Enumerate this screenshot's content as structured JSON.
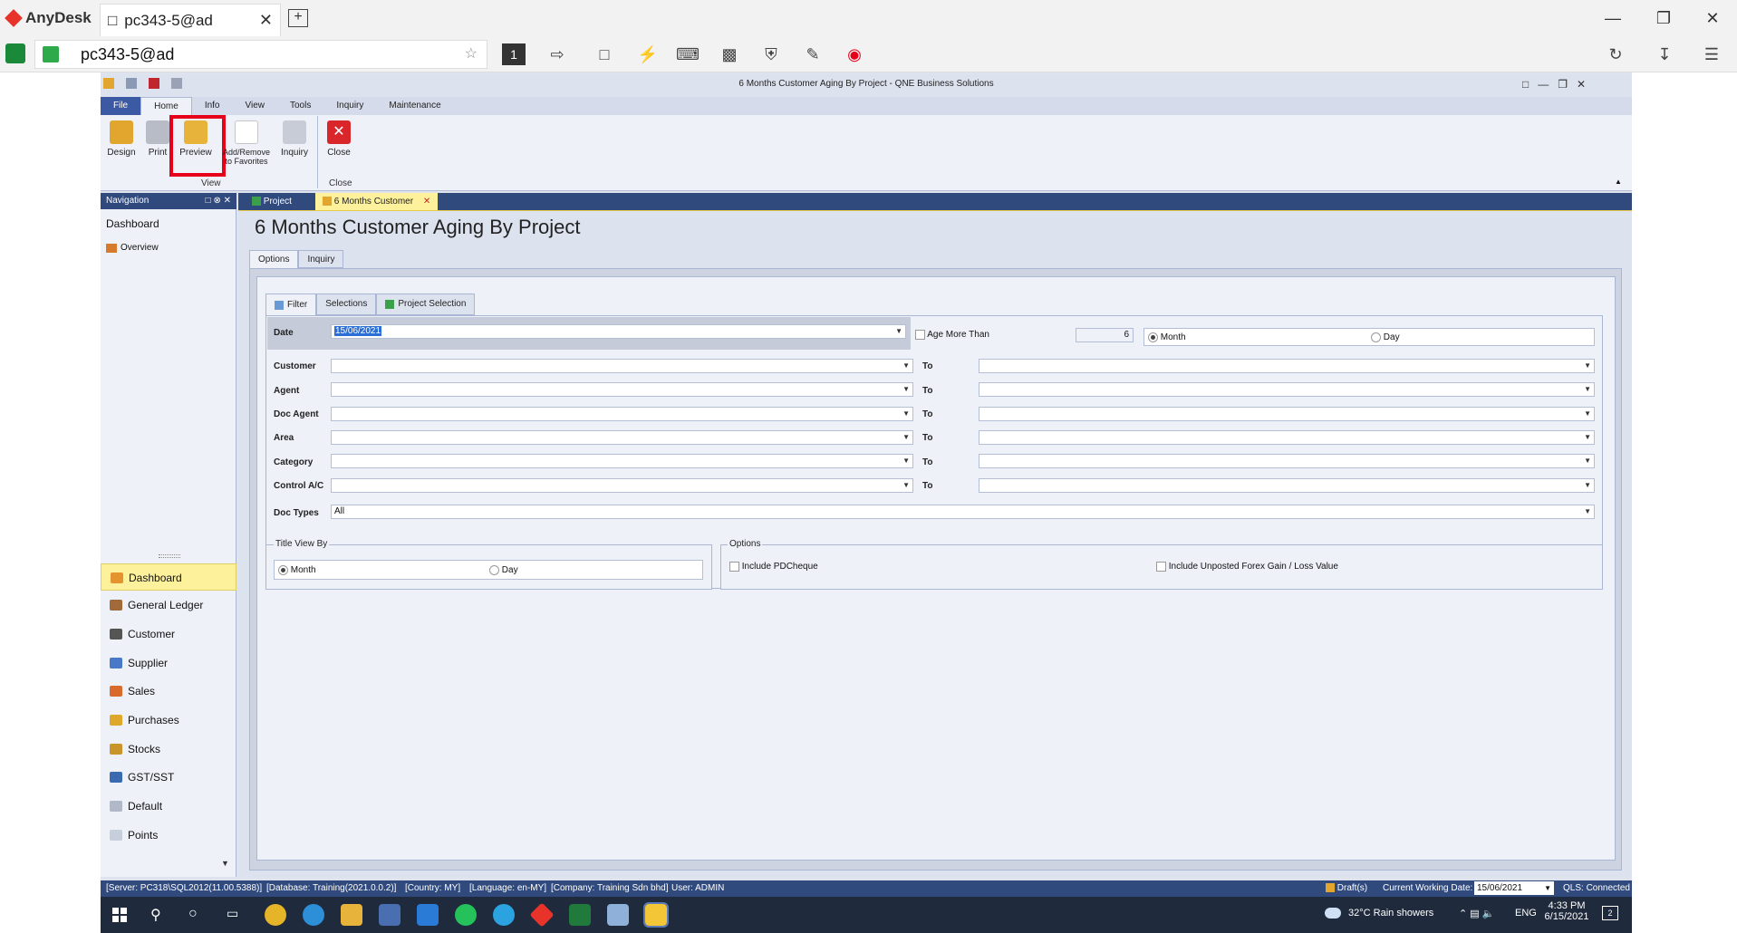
{
  "anydesk": {
    "brand": "AnyDesk",
    "tab_label": "pc343-5@ad",
    "address": "pc343-5@ad",
    "session_number": "1"
  },
  "app": {
    "title": "6 Months Customer Aging By Project - QNE Business Solutions",
    "menu": [
      "File",
      "Home",
      "Info",
      "View",
      "Tools",
      "Inquiry",
      "Maintenance"
    ],
    "ribbon": {
      "buttons": [
        "Design",
        "Print",
        "Preview",
        "Add/Remove to Favorites",
        "Inquiry",
        "Close"
      ],
      "groups": {
        "view": "View",
        "close": "Close"
      }
    }
  },
  "navigation": {
    "header": "Navigation",
    "section": "Dashboard",
    "overview": "Overview",
    "items": [
      "Dashboard",
      "General Ledger",
      "Customer",
      "Supplier",
      "Sales",
      "Purchases",
      "Stocks",
      "GST/SST",
      "Default",
      "Points"
    ]
  },
  "doc_tabs": [
    "Project",
    "6 Months Customer"
  ],
  "page": {
    "title": "6 Months Customer Aging By Project",
    "tabs": [
      "Options",
      "Inquiry"
    ],
    "filter_tabs": [
      "Filter",
      "Selections",
      "Project Selection"
    ],
    "date_label": "Date",
    "date_value": "15/06/2021",
    "age_more_than": "Age More Than",
    "age_value": "6",
    "month": "Month",
    "day": "Day",
    "to": "To",
    "fields": [
      "Customer",
      "Agent",
      "Doc Agent",
      "Area",
      "Category",
      "Control A/C"
    ],
    "doc_types_label": "Doc Types",
    "doc_types_value": "All",
    "title_view_by": "Title View By",
    "options_title": "Options",
    "include_pdcheque": "Include PDCheque",
    "include_unposted": "Include Unposted Forex Gain / Loss Value"
  },
  "status": {
    "server": "[Server: PC318\\SQL2012(11.00.5388)]",
    "database": "[Database: Training(2021.0.0.2)]",
    "country": "[Country: MY]",
    "language": "[Language: en-MY]",
    "company": "[Company: Training Sdn bhd]",
    "user": "User: ADMIN",
    "drafts": "Draft(s)",
    "cwd_label": "Current Working Date:",
    "cwd_value": "15/06/2021",
    "qls": "QLS: Connected"
  },
  "taskbar": {
    "weather": "32°C  Rain showers",
    "lang": "ENG",
    "time": "4:33 PM",
    "date": "6/15/2021",
    "notif": "2"
  },
  "colors": {
    "accent": "#314a7e",
    "highlight": "#e6001a",
    "selected": "#fdf19b"
  }
}
